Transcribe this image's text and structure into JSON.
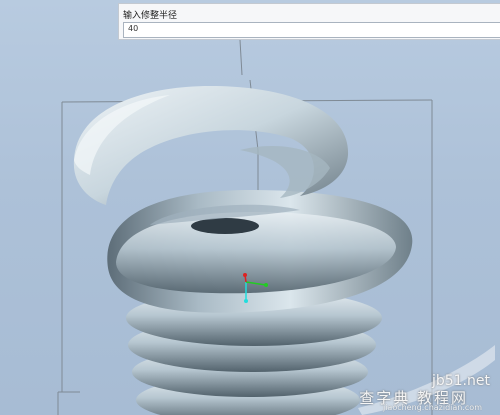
{
  "input_panel": {
    "label": "输入修整半径",
    "value": "40"
  },
  "watermark": {
    "site": "jb51.net",
    "name": "查字典 教程网",
    "url": "jiaocheng.chazidian.com"
  },
  "icons": {
    "csys": "coordinate-system-icon"
  },
  "colors": {
    "background_top": "#b8cbe0",
    "background_bottom": "#a7bcd4",
    "surface": "#c4d3dc",
    "surface_shadow": "#4d5d68",
    "axis_x": "#22cc22",
    "axis_y": "#dd2222",
    "axis_z": "#22dddd"
  }
}
